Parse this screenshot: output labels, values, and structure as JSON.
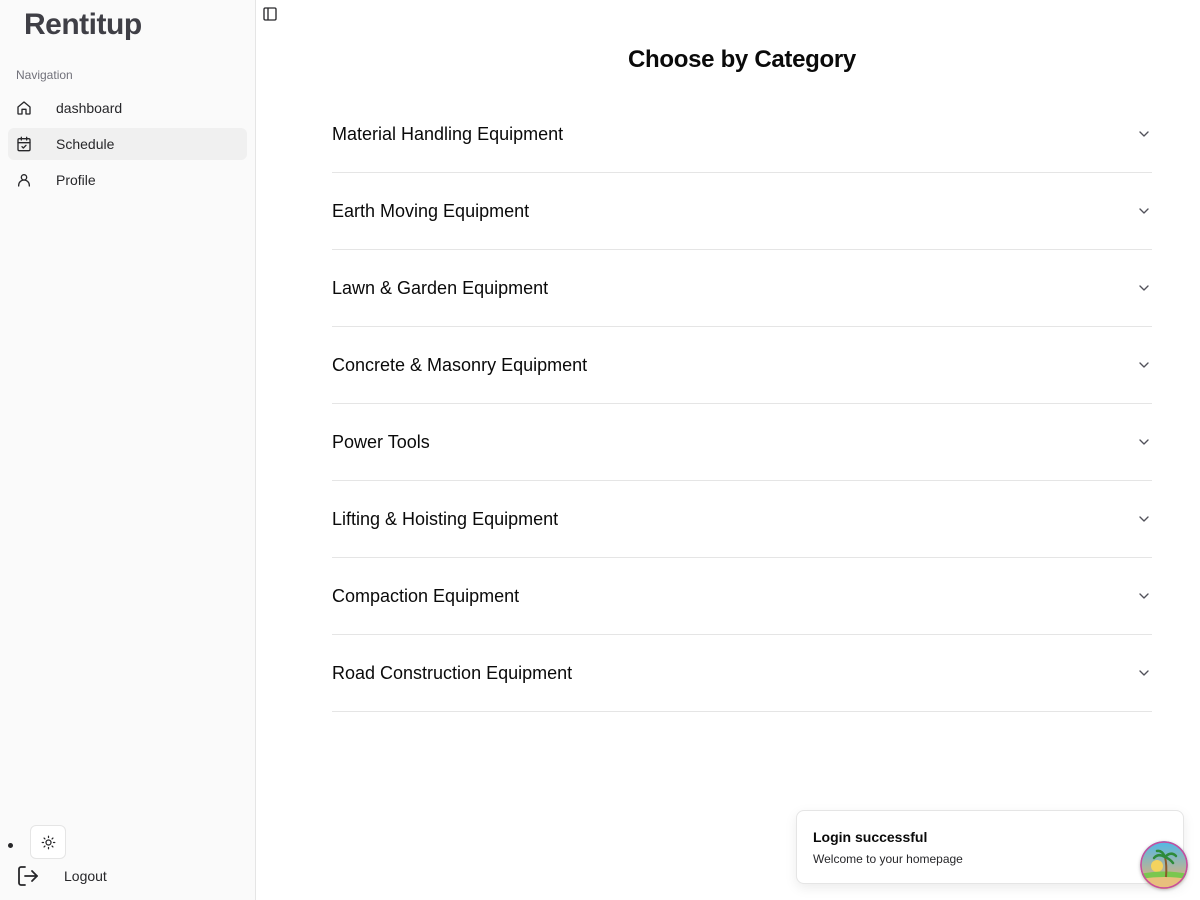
{
  "app": {
    "logo": "Rentitup"
  },
  "sidebar": {
    "group_label": "Navigation",
    "items": [
      {
        "label": "dashboard",
        "icon": "home-icon"
      },
      {
        "label": "Schedule",
        "icon": "calendar-check-icon",
        "active": true
      },
      {
        "label": "Profile",
        "icon": "user-icon"
      }
    ],
    "theme_toggle_icon": "sun-icon",
    "logout_label": "Logout"
  },
  "main": {
    "title": "Choose by Category",
    "categories": [
      "Material Handling Equipment",
      "Earth Moving Equipment",
      "Lawn & Garden Equipment",
      "Concrete & Masonry Equipment",
      "Power Tools",
      "Lifting & Hoisting Equipment",
      "Compaction Equipment",
      "Road Construction Equipment"
    ]
  },
  "toast": {
    "title": "Login successful",
    "description": "Welcome to your homepage"
  },
  "colors": {
    "sidebar_bg": "#fafafa",
    "active_item_bg": "#f0f0f0",
    "border": "#e5e5e5",
    "text": "#0a0a0a"
  }
}
